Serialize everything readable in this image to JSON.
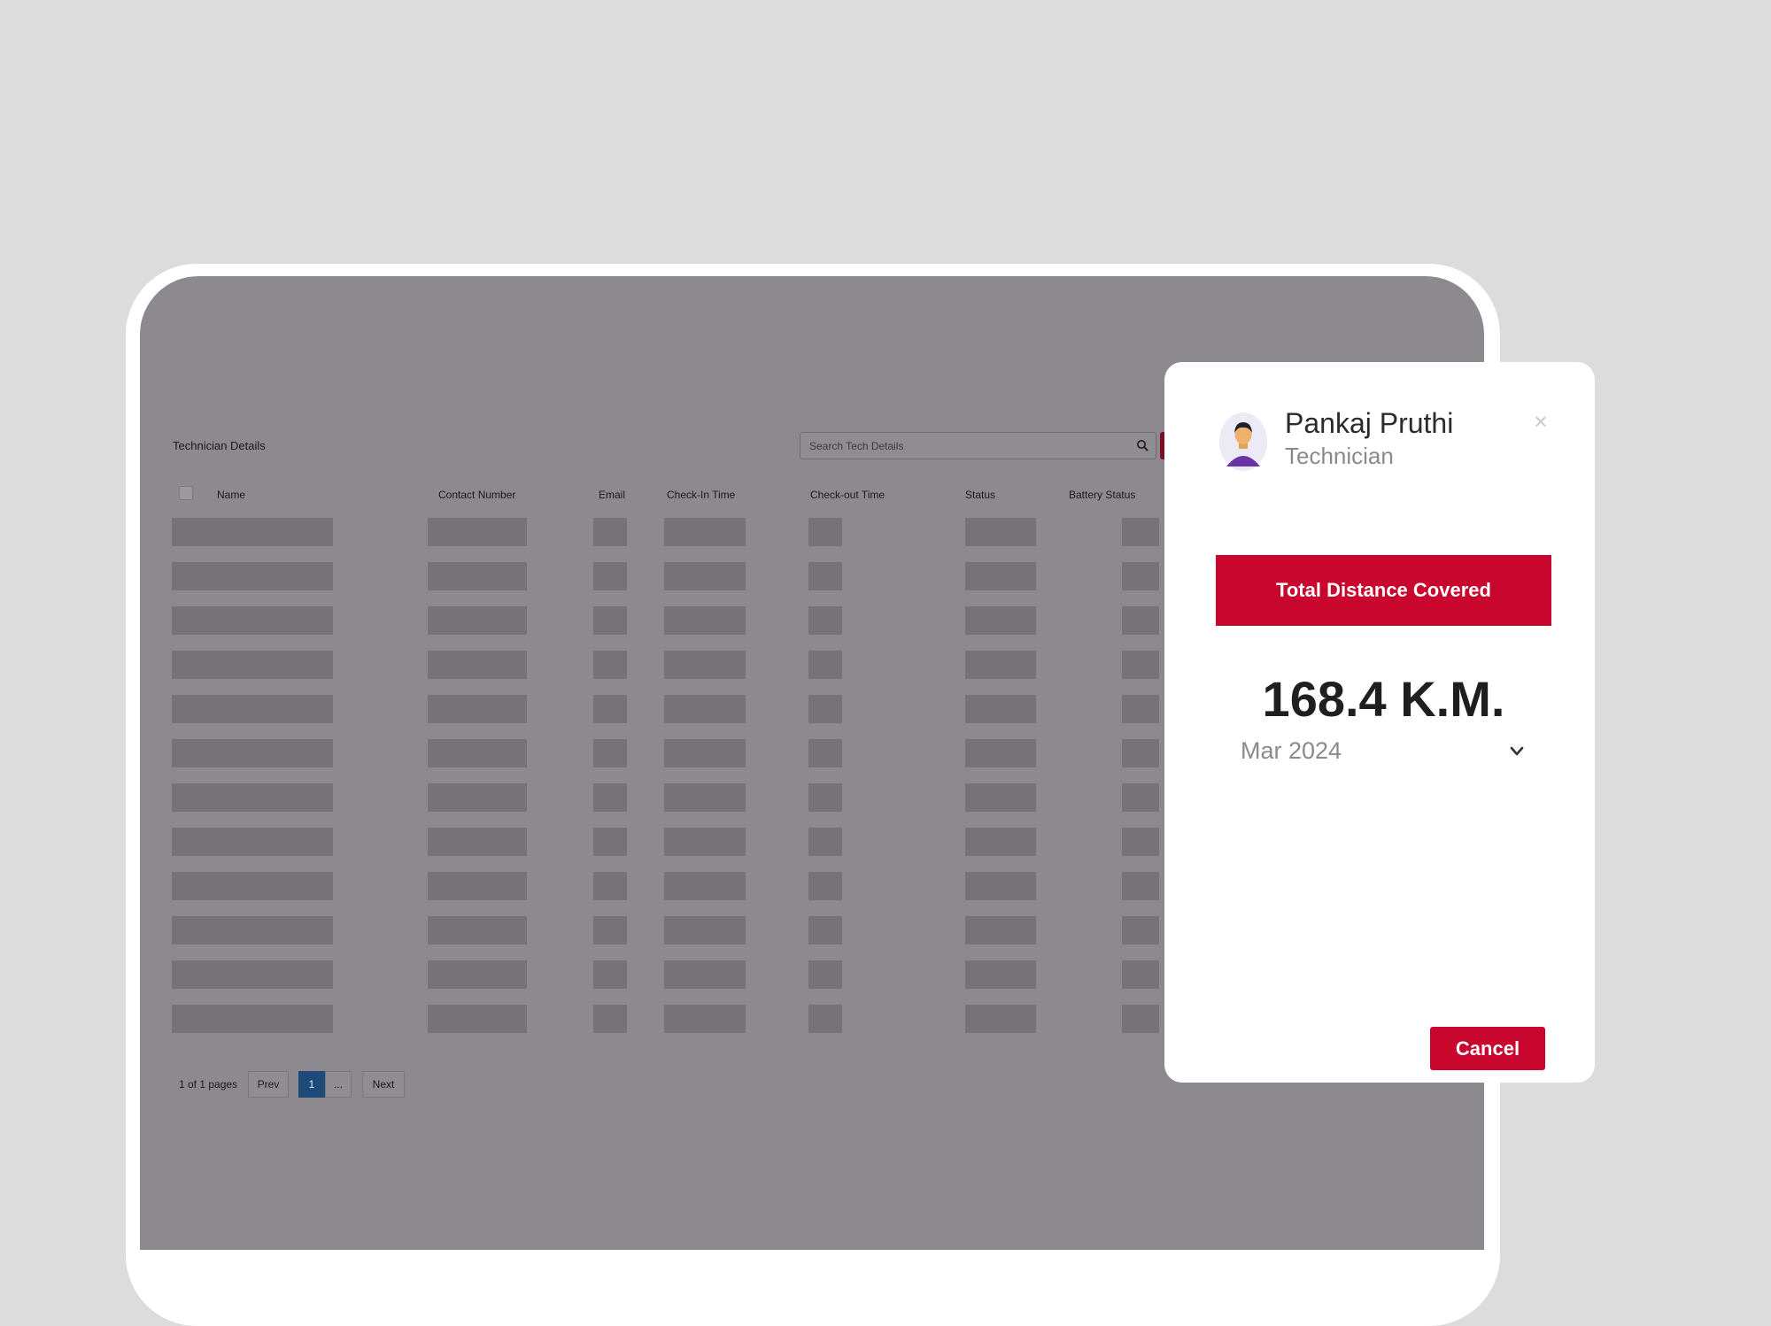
{
  "background": {
    "page_color": "#dcdcdd",
    "dim_overlay_color": "#8c8a8e"
  },
  "table_screen": {
    "title": "Technician Details",
    "search": {
      "placeholder": "Search Tech Details",
      "icon": "search-icon"
    },
    "columns": [
      "Name",
      "Contact Number",
      "Email",
      "Check-In Time",
      "Check-out Time",
      "Status",
      "Battery Status"
    ],
    "row_count": 12,
    "pagination": {
      "info": "1 of 1 pages",
      "prev_label": "Prev",
      "current_page": "1",
      "ellipsis": "...",
      "next_label": "Next"
    }
  },
  "modal": {
    "technician_name": "Pankaj Pruthi",
    "technician_role": "Technician",
    "close_icon": "×",
    "banner_title": "Total Distance Covered",
    "distance_value": "168.4 K.M.",
    "month_select": {
      "value": "Mar 2024",
      "icon": "chevron-down-icon"
    },
    "cancel_label": "Cancel",
    "accent_color": "#c8062e"
  }
}
